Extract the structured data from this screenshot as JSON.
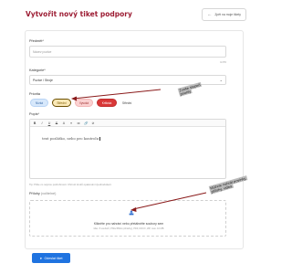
{
  "header": {
    "title": "Vytvořit nový tiket podpory",
    "back_label": "Zpět na moje tikety"
  },
  "form": {
    "subject": {
      "label": "Předmět",
      "required_mark": "*",
      "placeholder": "Název pozice",
      "counter": "0/255"
    },
    "category": {
      "label": "Kategorie",
      "required_mark": "*",
      "value": "Pozice / Stroje"
    },
    "priority": {
      "label": "Priorita",
      "options": [
        "Nízká",
        "Střední",
        "Vysoká",
        "Kritická"
      ],
      "selected": "Střední",
      "note": "Střední"
    },
    "description": {
      "label": "Popis",
      "required_mark": "*",
      "toolbar": [
        "B",
        "I",
        "U",
        "S",
        "A",
        "≡",
        "≔",
        "🔗",
        "⊘"
      ],
      "text": "text pozlátko, nebo pro kontrolu",
      "helper": "Tip: Pište co nejvíce podrobností. Uhrnutí kroků opakování zjednodušení."
    },
    "attachments": {
      "label": "Přílohy",
      "optional_label": "(volitelné)",
      "title": "Klikněte pro nahrání nebo přetáhněte soubory sem",
      "subtitle": "Max. 5 souborů, PNG/JPEG (obrázky), PDF, DOCX, ZIP, max. 10 MB"
    },
    "submit_label": "Odeslat tiket"
  },
  "annotations": {
    "priority_callout": [
      "Zvolte stupeň",
      "priority"
    ],
    "upload_callout": [
      "Můžete nahrát povinky,",
      "přílohy, videa"
    ]
  },
  "colors": {
    "title": "#9c1c33",
    "primary": "#1f73e0",
    "danger": "#d93838",
    "warning_bg": "#fbe9b7"
  }
}
